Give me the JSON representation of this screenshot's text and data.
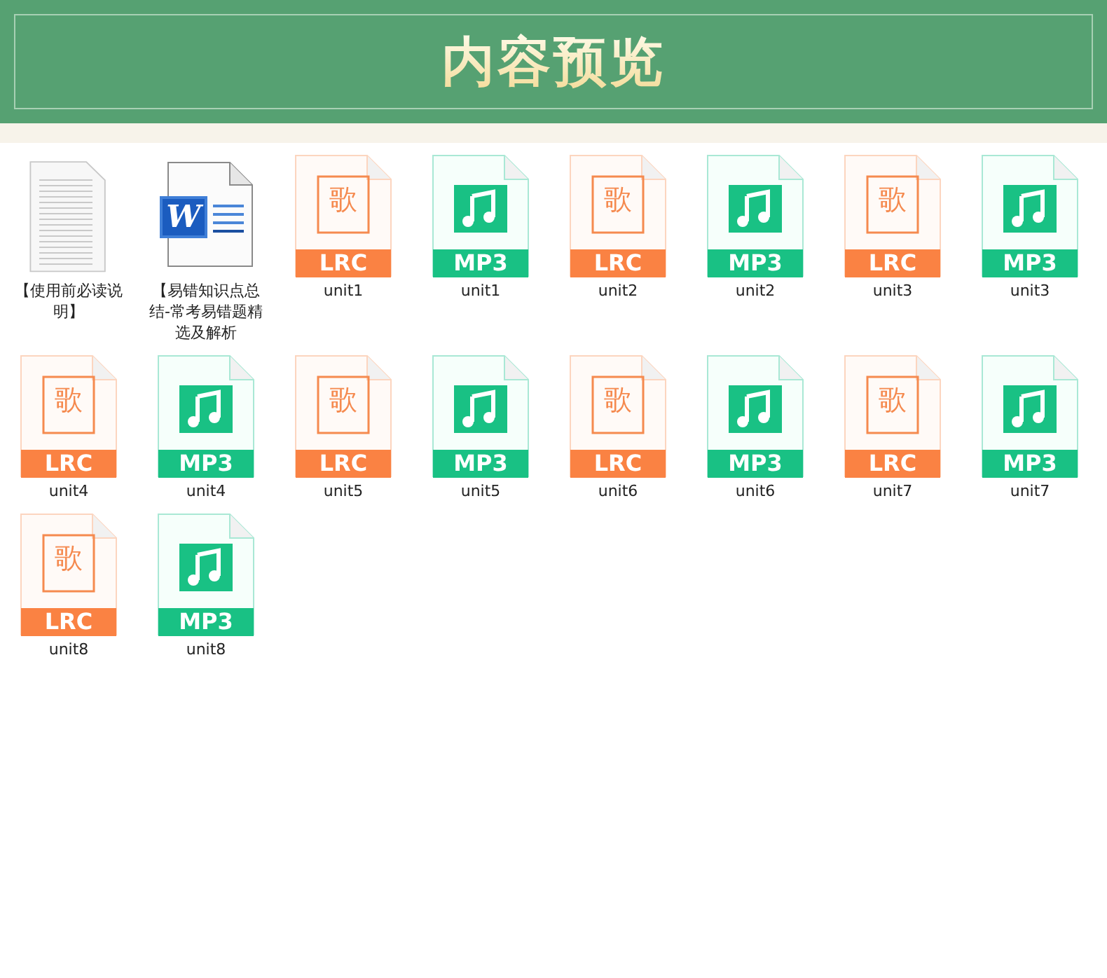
{
  "header": {
    "title": "内容预览"
  },
  "files": [
    {
      "kind": "text",
      "name": "【使用前必读说明】"
    },
    {
      "kind": "word",
      "logo": "W",
      "name": "【易错知识点总结-常考易错题精选及解析"
    },
    {
      "kind": "lrc",
      "glyph": "歌",
      "badge": "LRC",
      "name": "unit1"
    },
    {
      "kind": "mp3",
      "badge": "MP3",
      "name": "unit1"
    },
    {
      "kind": "lrc",
      "glyph": "歌",
      "badge": "LRC",
      "name": "unit2"
    },
    {
      "kind": "mp3",
      "badge": "MP3",
      "name": "unit2"
    },
    {
      "kind": "lrc",
      "glyph": "歌",
      "badge": "LRC",
      "name": "unit3"
    },
    {
      "kind": "mp3",
      "badge": "MP3",
      "name": "unit3"
    },
    {
      "kind": "lrc",
      "glyph": "歌",
      "badge": "LRC",
      "name": "unit4"
    },
    {
      "kind": "mp3",
      "badge": "MP3",
      "name": "unit4"
    },
    {
      "kind": "lrc",
      "glyph": "歌",
      "badge": "LRC",
      "name": "unit5"
    },
    {
      "kind": "mp3",
      "badge": "MP3",
      "name": "unit5"
    },
    {
      "kind": "lrc",
      "glyph": "歌",
      "badge": "LRC",
      "name": "unit6"
    },
    {
      "kind": "mp3",
      "badge": "MP3",
      "name": "unit6"
    },
    {
      "kind": "lrc",
      "glyph": "歌",
      "badge": "LRC",
      "name": "unit7"
    },
    {
      "kind": "mp3",
      "badge": "MP3",
      "name": "unit7"
    },
    {
      "kind": "lrc",
      "glyph": "歌",
      "badge": "LRC",
      "name": "unit8"
    },
    {
      "kind": "mp3",
      "badge": "MP3",
      "name": "unit8"
    }
  ]
}
